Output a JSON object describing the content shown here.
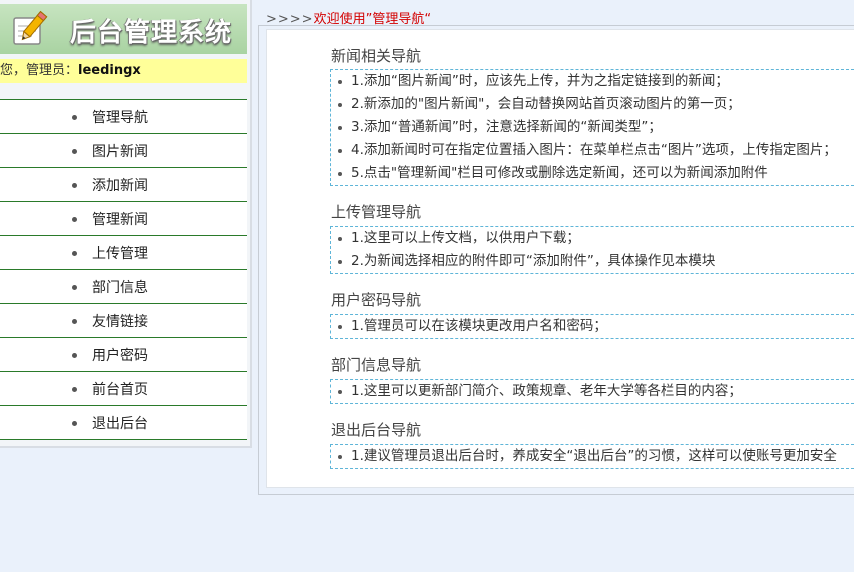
{
  "logo": {
    "title": "后台管理系统",
    "icon": "pencil-notepad-icon"
  },
  "welcome": {
    "prefix": "您，管理员：",
    "username": "leedingx"
  },
  "menu": [
    "管理导航",
    "图片新闻",
    "添加新闻",
    "管理新闻",
    "上传管理",
    "部门信息",
    "友情链接",
    "用户密码",
    "前台首页",
    "退出后台"
  ],
  "breadcrumb": {
    "arrows": ">>>>",
    "text": "欢迎使用”管理导航“"
  },
  "sections": [
    {
      "title": "新闻相关导航",
      "items": [
        "1.添加“图片新闻”时，应该先上传，并为之指定链接到的新闻；",
        "2.新添加的\"图片新闻\"，会自动替换网站首页滚动图片的第一页；",
        "3.添加“普通新闻”时，注意选择新闻的“新闻类型”；",
        "4.添加新闻时可在指定位置插入图片：在菜单栏点击“图片”选项，上传指定图片；",
        "5.点击\"管理新闻\"栏目可修改或删除选定新闻，还可以为新闻添加附件"
      ]
    },
    {
      "title": "上传管理导航",
      "items": [
        "1.这里可以上传文档，以供用户下载；",
        "2.为新闻选择相应的附件即可“添加附件”，具体操作见本模块"
      ]
    },
    {
      "title": "用户密码导航",
      "items": [
        "1.管理员可以在该模块更改用户名和密码；"
      ]
    },
    {
      "title": "部门信息导航",
      "items": [
        "1.这里可以更新部门简介、政策规章、老年大学等各栏目的内容；"
      ]
    },
    {
      "title": "退出后台导航",
      "items": [
        "1.建议管理员退出后台时，养成安全“退出后台”的习惯，这样可以使账号更加安全"
      ]
    }
  ],
  "colors": {
    "menu_border": "#2a7a2a",
    "welcome_bg": "#ffff99",
    "breadcrumb_text": "#d30000",
    "box_border": "#5fb5d8"
  }
}
